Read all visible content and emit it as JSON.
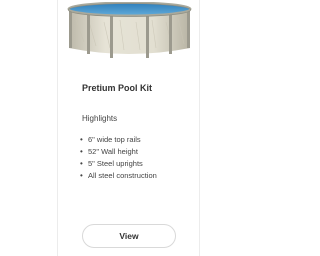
{
  "product": {
    "title": "Pretium Pool Kit",
    "image_icon": "above-ground-pool-image",
    "highlights_label": "Highlights",
    "features": [
      "6\" wide top rails",
      "52\" Wall height",
      "5\" Steel uprights",
      "All steel construction"
    ],
    "view_label": "View"
  },
  "colors": {
    "pool_wall": "#dcd8c8",
    "pool_rail": "#a9a99c",
    "water": "#3f8fc7",
    "border": "#ececec"
  }
}
